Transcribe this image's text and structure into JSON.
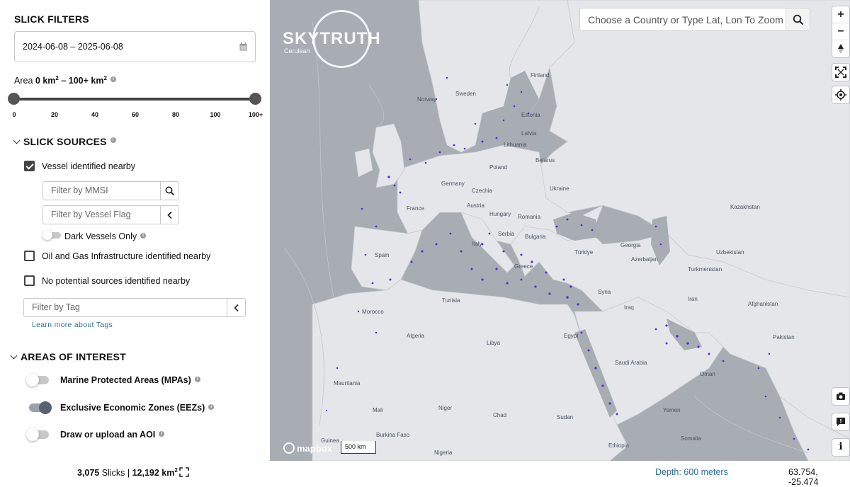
{
  "sidebar": {
    "title": "SLICK FILTERS",
    "date_range": "2024-06-08 – 2025-06-08",
    "area": {
      "prefix": "Area ",
      "min": "0 km",
      "sep": " – ",
      "max": "100+ km",
      "unit_sup": "2",
      "range_min": 0,
      "range_max": 100,
      "ticks": [
        "0",
        "20",
        "40",
        "60",
        "80",
        "100",
        "100+"
      ]
    },
    "slick_sources": {
      "title": "SLICK SOURCES",
      "vessel_label": "Vessel identified nearby",
      "vessel_checked": true,
      "mmsi_placeholder": "Filter by MMSI",
      "flag_placeholder": "Filter by Vessel Flag",
      "dark_vessels_label": "Dark Vessels Only",
      "oil_gas_label": "Oil and Gas Infrastructure identified nearby",
      "no_sources_label": "No potential sources identified nearby",
      "tag_placeholder": "Filter by Tag",
      "learn_more": "Learn more about Tags"
    },
    "areas_of_interest": {
      "title": "AREAS OF INTEREST",
      "items": [
        {
          "label": "Marine Protected Areas (MPAs)",
          "on": false
        },
        {
          "label": "Exclusive Economic Zones (EEZs)",
          "on": true
        },
        {
          "label": "Draw or upload an AOI",
          "on": false
        }
      ]
    }
  },
  "map": {
    "search_placeholder": "Choose a Country or Type Lat, Lon To Zoom",
    "logo_text": "SKYTRUTH",
    "logo_sub": "Cerulean",
    "attribution": "mapbox",
    "scale_label": "500 km",
    "zoom_in": "+",
    "zoom_out": "−",
    "info_button": "i",
    "labels": {
      "sweden": "Sweden",
      "finland": "Finland",
      "norway": "Norway",
      "estonia": "Estonia",
      "latvia": "Latvia",
      "lithuania": "Lithuania",
      "belarus": "Belarus",
      "poland": "Poland",
      "germany": "Germany",
      "ukraine": "Ukraine",
      "czechia": "Czechia",
      "austria": "Austria",
      "hungary": "Hungary",
      "romania": "Romania",
      "france": "France",
      "serbia": "Serbia",
      "bulgaria": "Bulgaria",
      "spain": "Spain",
      "italy": "Italy",
      "greece": "Greece",
      "turkiye": "Türkiye",
      "georgia": "Georgia",
      "azerbaijan": "Azerbaijan",
      "turkmenistan": "Turkmenistan",
      "kazakhstan": "Kazakhstan",
      "uzbekistan": "Uzbekistan",
      "iran": "Iran",
      "iraq": "Iraq",
      "syria": "Syria",
      "tunisia": "Tunisia",
      "morocco": "Morocco",
      "algeria": "Algeria",
      "libya": "Libya",
      "egypt": "Egypt",
      "saudi": "Saudi Arabia",
      "oman": "Oman",
      "yemen": "Yemen",
      "pakistan": "Pakistan",
      "afghanistan": "Afghanistan",
      "mali": "Mali",
      "niger": "Niger",
      "chad": "Chad",
      "sudan": "Sudan",
      "ethiopia": "Ethiopia",
      "mauritania": "Mauritania",
      "nigeria": "Nigeria",
      "somalia": "Somalia",
      "burkina": "Burkina Faso",
      "guinea": "Guinea"
    }
  },
  "footer": {
    "slicks_count": "3,075",
    "slicks_word": " Slicks | ",
    "area_total": "12,192 km",
    "area_sup": "2",
    "depth": "Depth: 600 meters",
    "coords": "63.754, -25.474"
  }
}
